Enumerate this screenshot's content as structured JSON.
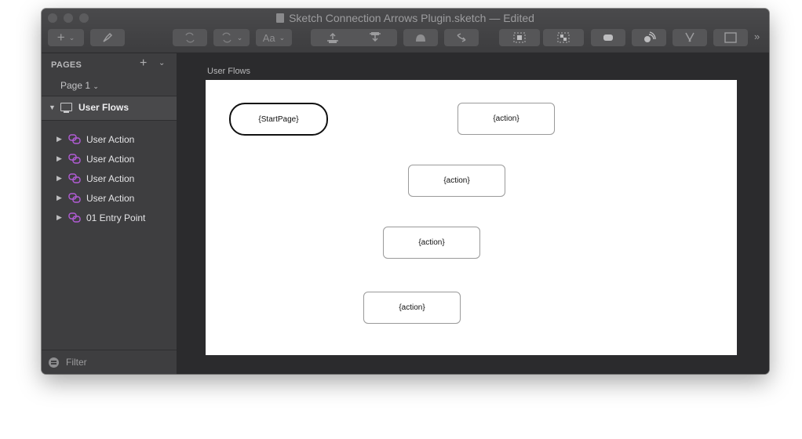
{
  "window": {
    "title": "Sketch Connection Arrows Plugin.sketch — Edited"
  },
  "toolbar": {
    "text_tool": "Aa"
  },
  "sidebar": {
    "pages_header": "PAGES",
    "current_page": "Page 1",
    "page_item": "User Flows",
    "layers": [
      {
        "label": "User Action"
      },
      {
        "label": "User Action"
      },
      {
        "label": "User Action"
      },
      {
        "label": "User Action"
      },
      {
        "label": "01 Entry Point"
      }
    ],
    "filter": "Filter"
  },
  "canvas": {
    "artboard_title": "User Flows",
    "nodes": [
      {
        "label": "{StartPage}"
      },
      {
        "label": "{action}"
      },
      {
        "label": "{action}"
      },
      {
        "label": "{action}"
      },
      {
        "label": "{action}"
      }
    ]
  },
  "colors": {
    "symbol_icon": "#b25cd6",
    "window_bg": "#3a3a3c",
    "canvas_bg": "#2b2b2d"
  }
}
